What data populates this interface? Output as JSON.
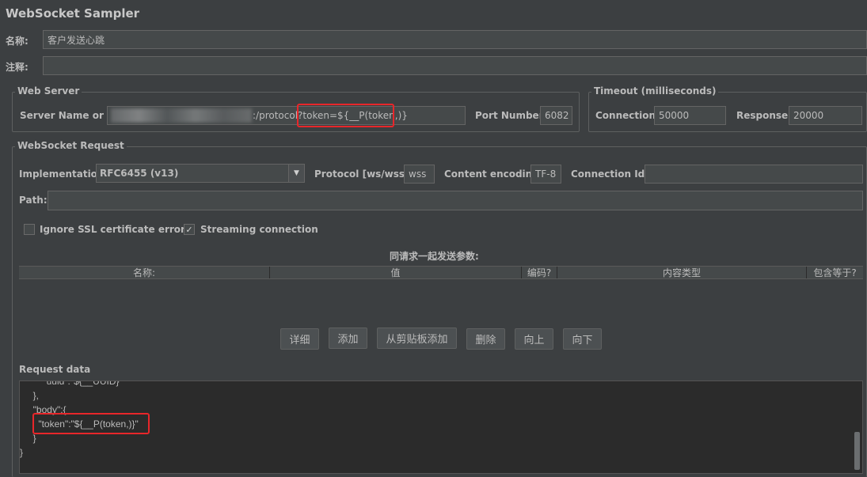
{
  "title": "WebSocket Sampler",
  "name_label": "名称:",
  "name_value": "客户发送心跳",
  "comment_label": "注释:",
  "comment_value": "",
  "web_server": {
    "legend": "Web Server",
    "server_label": "Server Name or IP:",
    "server_value_visible": ":/protocol?token=${__P(token,)}",
    "port_label": "Port Number:",
    "port_value": "6082"
  },
  "timeout": {
    "legend": "Timeout (milliseconds)",
    "connection_label": "Connection:",
    "connection_value": "50000",
    "response_label": "Response:",
    "response_value": "20000"
  },
  "ws_request": {
    "legend": "WebSocket Request",
    "implementation_label": "Implementation:",
    "implementation_value": "RFC6455 (v13)",
    "protocol_label": "Protocol [ws/wss]:",
    "protocol_value": "wss",
    "encoding_label": "Content encoding:",
    "encoding_value": "TF-8",
    "connection_id_label": "Connection Id:",
    "connection_id_value": "",
    "path_label": "Path:",
    "path_value": "",
    "ignore_ssl_label": "Ignore SSL certificate errors",
    "ignore_ssl_checked": false,
    "streaming_label": "Streaming connection",
    "streaming_checked": true
  },
  "params": {
    "caption": "同请求一起发送参数:",
    "columns": [
      "名称:",
      "值",
      "编码?",
      "内容类型",
      "包含等于?"
    ],
    "rows": []
  },
  "buttons": {
    "detail": "详细",
    "add": "添加",
    "add_clipboard": "从剪贴板添加",
    "delete": "删除",
    "up": "向上",
    "down": "向下"
  },
  "request_data": {
    "label": "Request data",
    "lines": [
      "  },",
      "  \"body\":{",
      "    \"token\":\"${__P(token,)}\"",
      "  }",
      "}"
    ],
    "partial_top_line": "    \"uuid\":\"${__UUID}\""
  }
}
